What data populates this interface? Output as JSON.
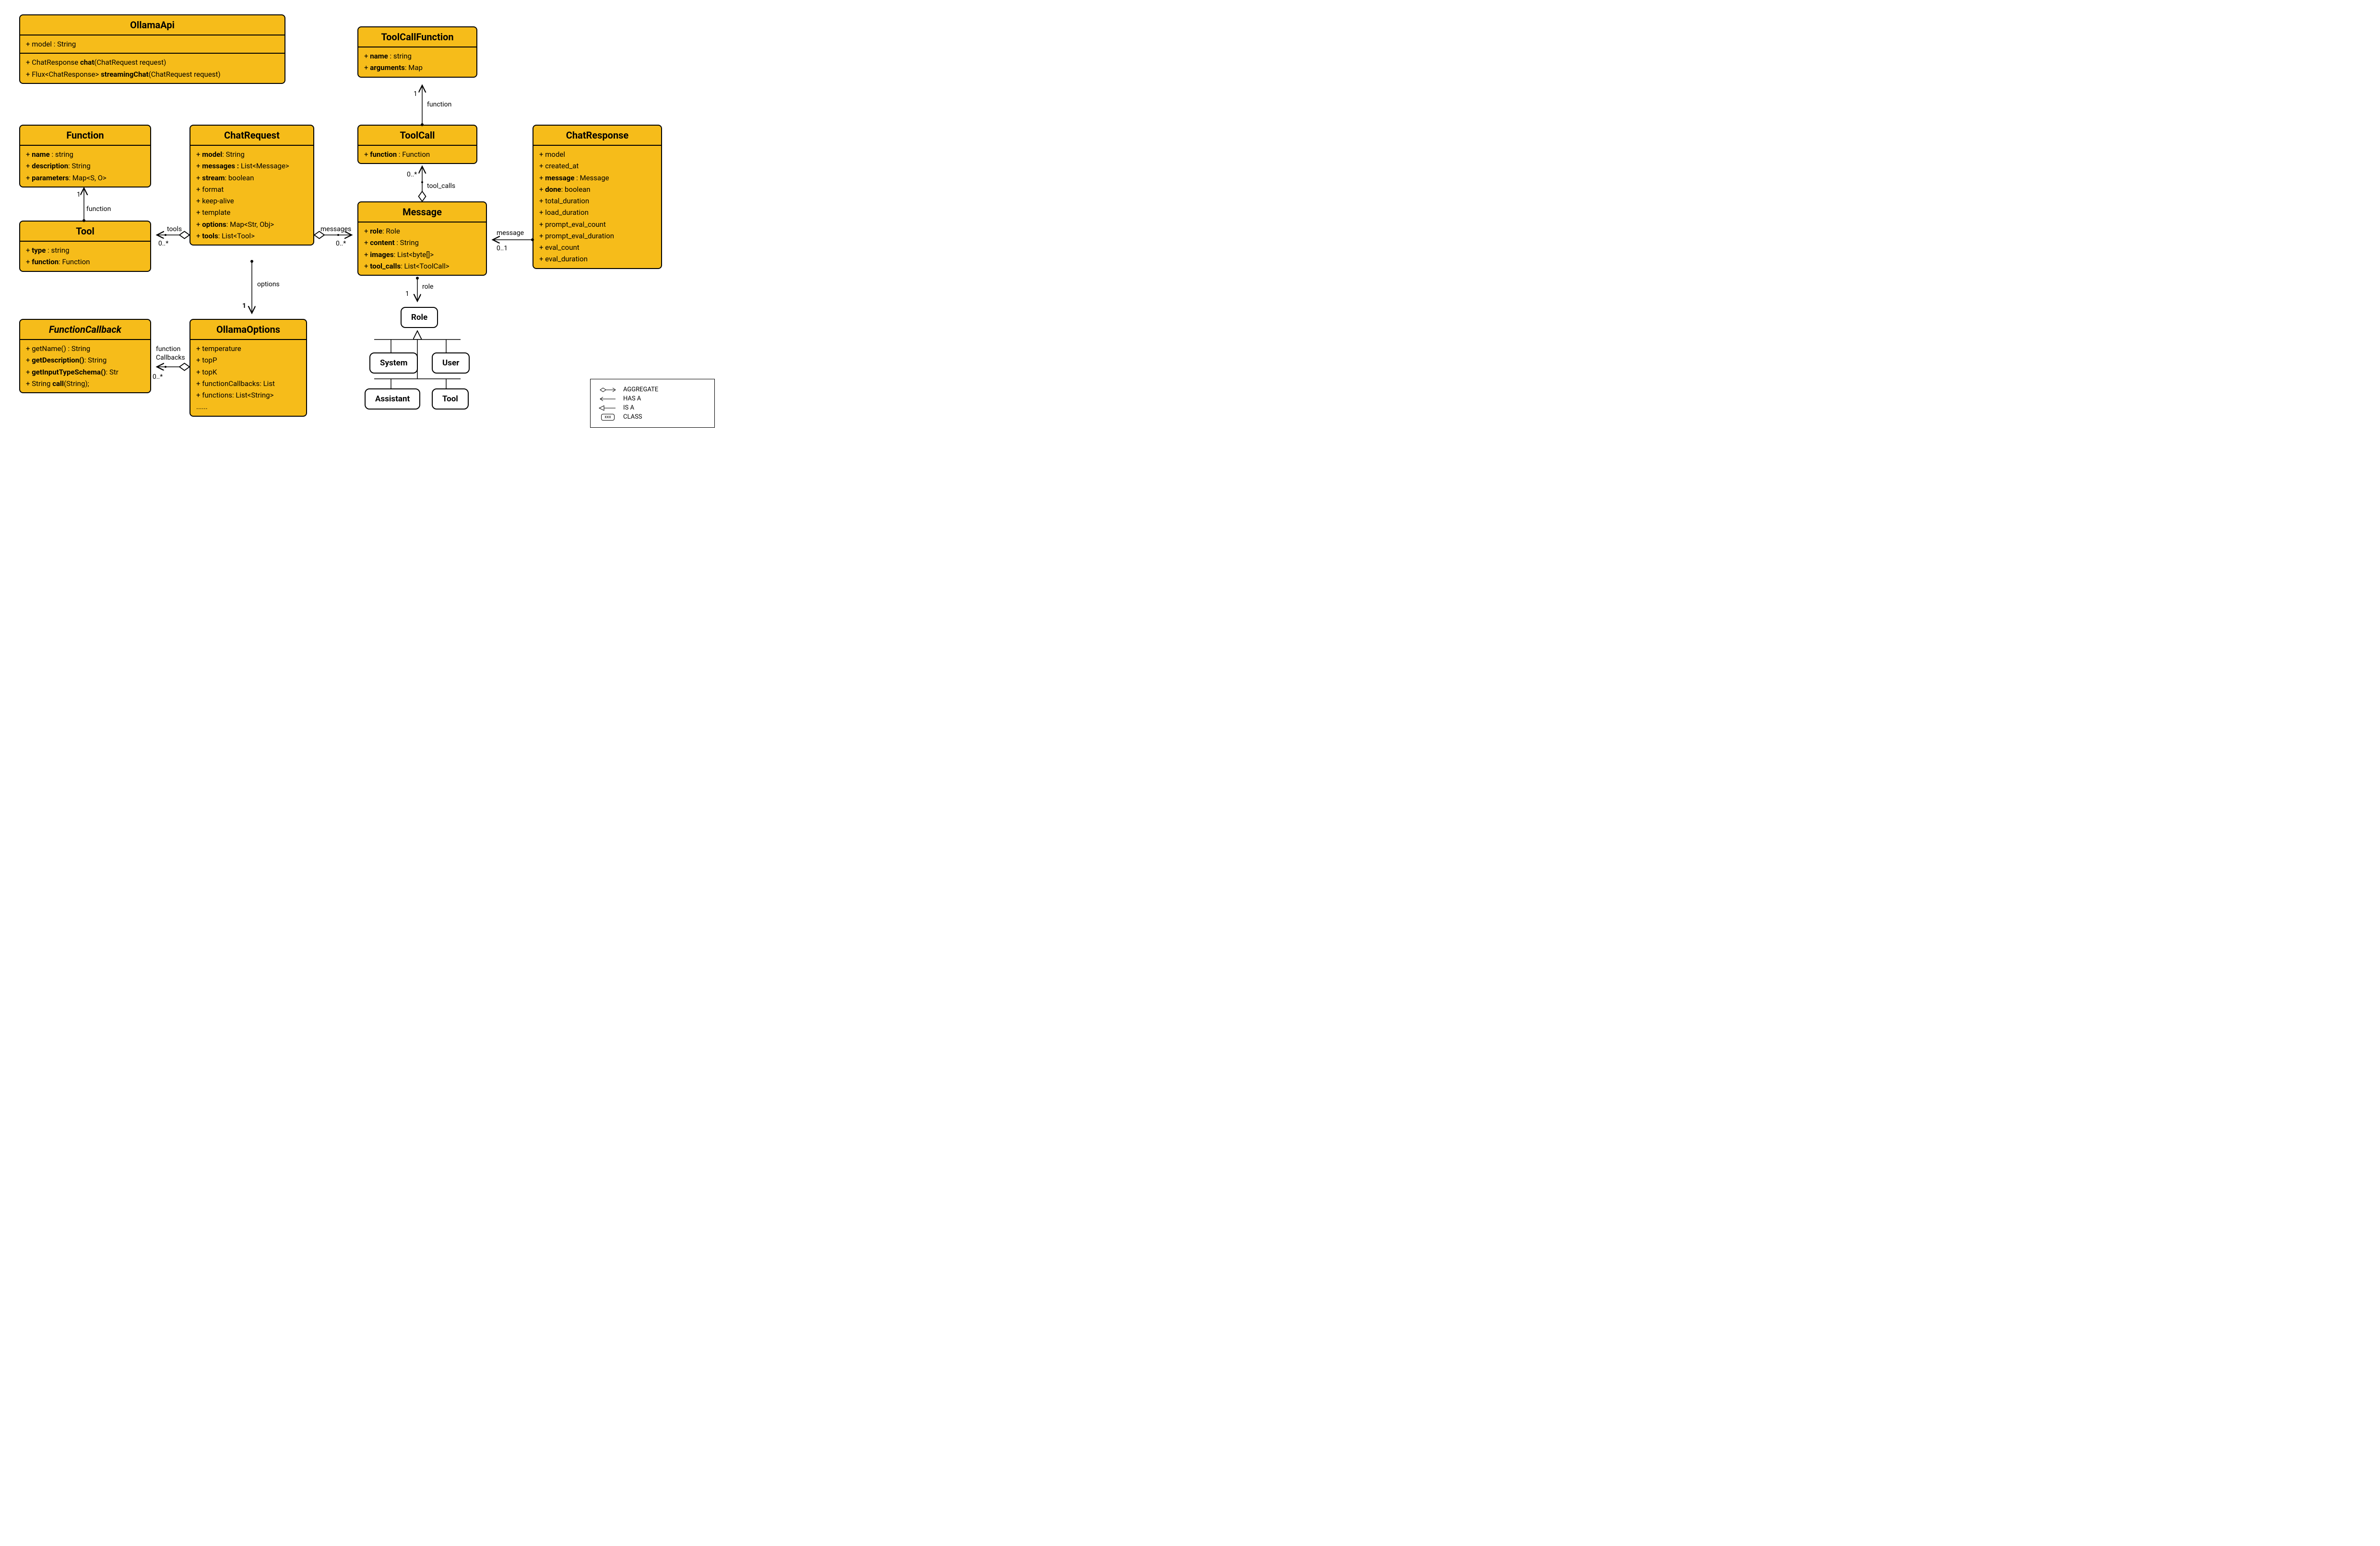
{
  "classes": {
    "OllamaApi": {
      "title": "OllamaApi",
      "attrs": [
        "+ model : String"
      ],
      "ops": [
        {
          "pre": "+ ChatResponse ",
          "bold": "chat",
          "post": "(ChatRequest request)"
        },
        {
          "pre": "+ Flux<ChatResponse> ",
          "bold": "streamingChat",
          "post": "(ChatRequest request)"
        }
      ]
    },
    "Function": {
      "title": "Function",
      "attrs": [
        {
          "pre": "+ ",
          "bold": "name",
          "post": " : string"
        },
        {
          "pre": "+ ",
          "bold": "description",
          "post": ": String"
        },
        {
          "pre": "+ ",
          "bold": "parameters",
          "post": ": Map<S, O>"
        }
      ]
    },
    "Tool": {
      "title": "Tool",
      "attrs": [
        {
          "pre": "+ ",
          "bold": "type",
          "post": " : string"
        },
        {
          "pre": "+ ",
          "bold": "function",
          "post": ": Function"
        }
      ]
    },
    "FunctionCallback": {
      "title": "FunctionCallback",
      "attrs": [
        "+ getName() : String",
        {
          "pre": "+ ",
          "bold": "getDescription()",
          "post": ": String"
        },
        {
          "pre": "+ ",
          "bold": "getInputTypeSchema()",
          "post": ": Str"
        },
        {
          "pre": "+ String ",
          "bold": "call",
          "post": "(String);"
        }
      ]
    },
    "ChatRequest": {
      "title": "ChatRequest",
      "attrs": [
        {
          "pre": "+ ",
          "bold": "model",
          "post": ": String"
        },
        {
          "pre": "+ ",
          "bold": "messages :",
          "post": " List<Message>"
        },
        {
          "pre": "+ ",
          "bold": "stream",
          "post": ": boolean"
        },
        "+ format",
        "+ keep-alive",
        "+ template",
        {
          "pre": "+ ",
          "bold": "options",
          "post": ": Map<Str, Obj>"
        },
        {
          "pre": "+ ",
          "bold": "tools",
          "post": ": List<Tool>"
        }
      ]
    },
    "OllamaOptions": {
      "title": "OllamaOptions",
      "attrs": [
        "+ temperature",
        "+ topP",
        "+ topK",
        "+ functionCallbacks: List",
        "+ functions: List<String>",
        "......"
      ]
    },
    "ToolCallFunction": {
      "title": "ToolCallFunction",
      "attrs": [
        {
          "pre": "+ ",
          "bold": "name",
          "post": " : string"
        },
        {
          "pre": "+ ",
          "bold": "arguments",
          "post": ": Map"
        }
      ]
    },
    "ToolCall": {
      "title": "ToolCall",
      "attrs": [
        {
          "pre": "+ ",
          "bold": "function",
          "post": " : Function"
        }
      ]
    },
    "Message": {
      "title": "Message",
      "attrs": [
        {
          "pre": "+ ",
          "bold": "role",
          "post": ": Role"
        },
        {
          "pre": "+ ",
          "bold": "content",
          "post": " : String"
        },
        {
          "pre": "+ ",
          "bold": "images",
          "post": ": List<byte[]>"
        },
        {
          "pre": "+ ",
          "bold": "tool_calls",
          "post": ": List<ToolCall>"
        }
      ]
    },
    "ChatResponse": {
      "title": "ChatResponse",
      "attrs": [
        "+ model",
        "+ created_at",
        {
          "pre": "+ ",
          "bold": "message",
          "post": " : Message"
        },
        {
          "pre": "+ ",
          "bold": "done",
          "post": ": boolean"
        },
        "+ total_duration",
        "+ load_duration",
        "+ prompt_eval_count",
        "+ prompt_eval_duration",
        "+ eval_count",
        "+ eval_duration"
      ]
    }
  },
  "roles": {
    "parent": "Role",
    "children": [
      "System",
      "User",
      "Assistant",
      "Tool"
    ]
  },
  "edges": {
    "tool_function": {
      "label": "function",
      "m1": "1",
      "m2": ""
    },
    "chatreq_tools": {
      "label": "tools",
      "m": "0..*"
    },
    "chatreq_messages": {
      "label": "messages",
      "m": "0..*"
    },
    "chatreq_options": {
      "label": "options",
      "m": "1"
    },
    "options_fcb": {
      "label1": "function",
      "label2": "Callbacks",
      "m": "0..*"
    },
    "message_toolcalls": {
      "label": "tool_calls",
      "m": "0..*"
    },
    "toolcall_function": {
      "label": "function",
      "m": "1"
    },
    "message_role": {
      "label": "role",
      "m": "1"
    },
    "chatresp_message": {
      "label": "message",
      "m": "0..1"
    }
  },
  "legend": {
    "aggregate": "AGGREGATE",
    "hasa": "HAS A",
    "isa": "IS A",
    "class": "CLASS",
    "class_sample": "xxx"
  }
}
